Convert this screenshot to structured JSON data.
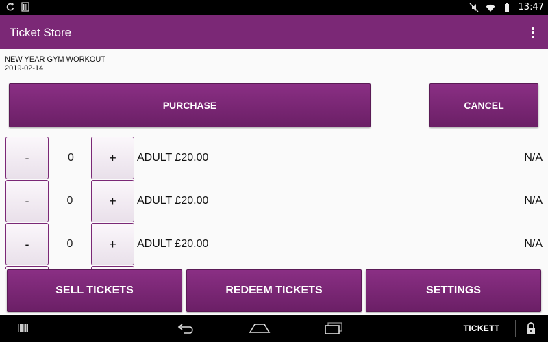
{
  "status_bar": {
    "time": "13:47",
    "icons": [
      "sync-icon",
      "sim-icon",
      "mute-icon",
      "wifi-icon",
      "battery-icon"
    ]
  },
  "app_bar": {
    "title": "Ticket Store",
    "menu_icon": "overflow-menu-icon"
  },
  "event": {
    "name": "NEW YEAR GYM WORKOUT",
    "date": "2019-02-14"
  },
  "actions": {
    "purchase_label": "PURCHASE",
    "cancel_label": "CANCEL"
  },
  "tickets": [
    {
      "minus_label": "-",
      "quantity": "0",
      "plus_label": "+",
      "label": "ADULT £20.00",
      "status": "N/A"
    },
    {
      "minus_label": "-",
      "quantity": "0",
      "plus_label": "+",
      "label": "ADULT £20.00",
      "status": "N/A"
    },
    {
      "minus_label": "-",
      "quantity": "0",
      "plus_label": "+",
      "label": "ADULT £20.00",
      "status": "N/A"
    }
  ],
  "bottom_actions": {
    "sell_label": "SELL TICKETS",
    "redeem_label": "REDEEM TICKETS",
    "settings_label": "SETTINGS"
  },
  "nav_bar": {
    "brand_label": "TICKETT",
    "icons": [
      "barcode-icon",
      "back-icon",
      "home-icon",
      "recents-icon",
      "lock-icon"
    ]
  },
  "colors": {
    "primary": "#7b2876",
    "button_gradient_top": "#8a2f84",
    "button_gradient_bottom": "#6b1f66",
    "stepper_border": "#7b2876"
  }
}
